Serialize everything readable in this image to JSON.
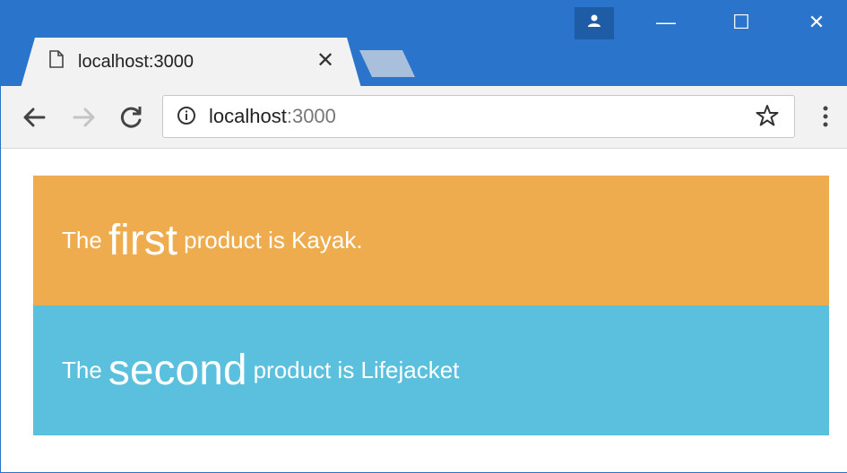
{
  "browser": {
    "tab": {
      "title": "localhost:3000",
      "close_glyph": "✕",
      "page_icon": "page-icon"
    },
    "window_controls": {
      "minimize_glyph": "—",
      "maximize_glyph": "☐",
      "close_glyph": "✕"
    },
    "toolbar": {
      "back_icon": "back-arrow-icon",
      "forward_icon": "forward-arrow-icon",
      "reload_icon": "reload-icon",
      "address": {
        "host": "localhost",
        "port": ":3000"
      },
      "bookmark_icon": "star-icon",
      "menu_icon": "kebab-menu-icon"
    },
    "colors": {
      "titlebar": "#2b74cb",
      "product_1_bg": "#efac4e",
      "product_2_bg": "#5bc0de"
    }
  },
  "page": {
    "products": [
      {
        "the": "The",
        "ordinal": "first",
        "rest": "product is Kayak."
      },
      {
        "the": "The",
        "ordinal": "second",
        "rest": "product is Lifejacket"
      }
    ]
  }
}
